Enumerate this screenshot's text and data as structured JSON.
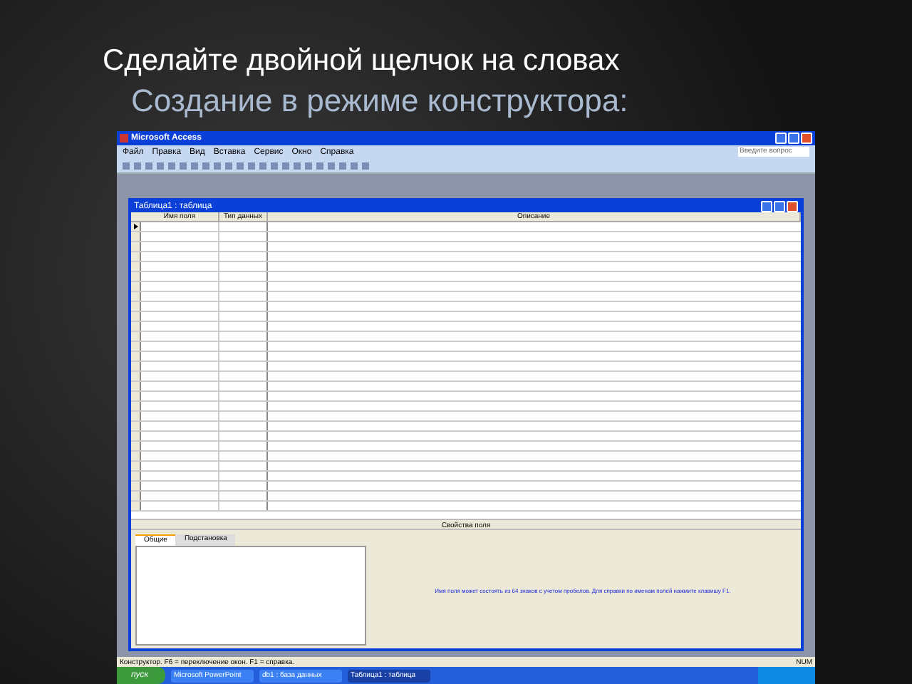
{
  "slide": {
    "title": "Сделайте двойной щелчок на словах",
    "subtitle": "Создание в режиме конструктора:"
  },
  "app": {
    "title": "Microsoft Access",
    "menu": [
      "Файл",
      "Правка",
      "Вид",
      "Вставка",
      "Сервис",
      "Окно",
      "Справка"
    ],
    "help_placeholder": "Введите вопрос"
  },
  "table_window": {
    "title": "Таблица1 : таблица",
    "columns": [
      "Имя поля",
      "Тип данных",
      "Описание"
    ],
    "properties_title": "Свойства поля",
    "tabs": [
      {
        "label": "Общие",
        "selected": true
      },
      {
        "label": "Подстановка",
        "selected": false
      }
    ],
    "hint": "Имя поля может состоять из 64 знаков с учетом пробелов. Для справки по именам полей нажмите клавишу F1."
  },
  "status_bar": {
    "text": "Конструктор. F6 = переключение окон. F1 = справка.",
    "indicator": "NUM"
  },
  "taskbar": {
    "start": "пуск",
    "tasks": [
      {
        "label": "Microsoft PowerPoint",
        "selected": false
      },
      {
        "label": "db1 : база данных",
        "selected": false
      },
      {
        "label": "Таблица1 : таблица",
        "selected": true
      }
    ]
  }
}
